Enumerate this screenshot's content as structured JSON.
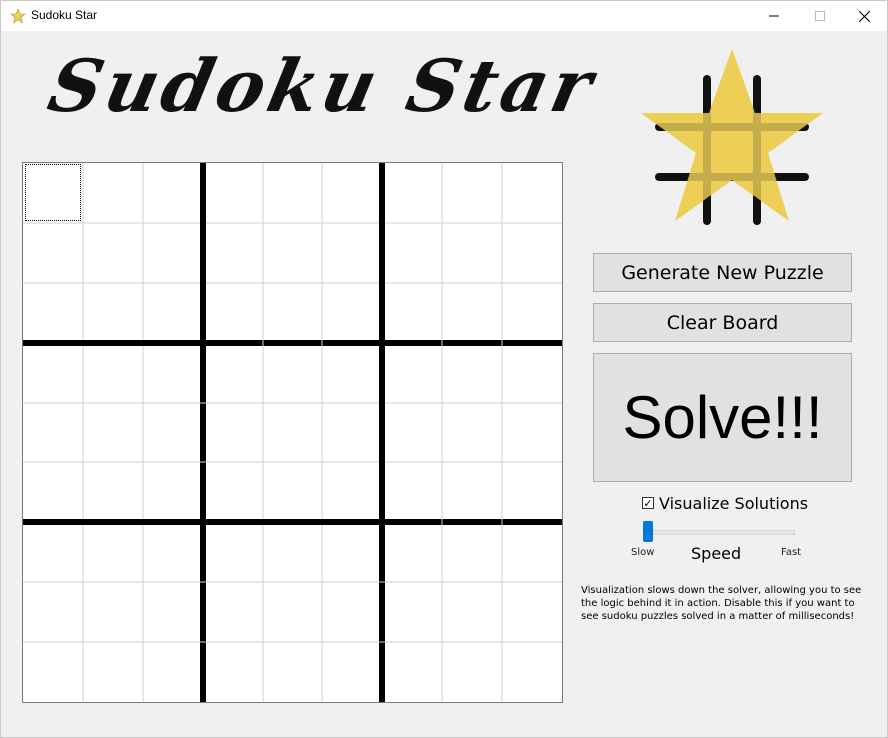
{
  "window": {
    "title": "Sudoku Star",
    "controls": [
      "minimize-icon",
      "maximize-icon",
      "close-icon"
    ]
  },
  "header": {
    "heading": "Sudoku Star",
    "logo_icon": "star-icon"
  },
  "board": {
    "size": 9,
    "cells": [
      [
        "",
        "",
        "",
        "",
        "",
        "",
        "",
        "",
        ""
      ],
      [
        "",
        "",
        "",
        "",
        "",
        "",
        "",
        "",
        ""
      ],
      [
        "",
        "",
        "",
        "",
        "",
        "",
        "",
        "",
        ""
      ],
      [
        "",
        "",
        "",
        "",
        "",
        "",
        "",
        "",
        ""
      ],
      [
        "",
        "",
        "",
        "",
        "",
        "",
        "",
        "",
        ""
      ],
      [
        "",
        "",
        "",
        "",
        "",
        "",
        "",
        "",
        ""
      ],
      [
        "",
        "",
        "",
        "",
        "",
        "",
        "",
        "",
        ""
      ],
      [
        "",
        "",
        "",
        "",
        "",
        "",
        "",
        "",
        ""
      ],
      [
        "",
        "",
        "",
        "",
        "",
        "",
        "",
        "",
        ""
      ]
    ]
  },
  "controls": {
    "generate_label": "Generate New Puzzle",
    "clear_label": "Clear Board",
    "solve_label": "Solve!!!",
    "visualize_label": "Visualize Solutions",
    "visualize_checked": true,
    "speed_label": "Speed",
    "slow_label": "Slow",
    "fast_label": "Fast",
    "speed_value": 0
  },
  "note": "Visualization slows down the solver, allowing you to see the logic behind it in action. Disable this if you want to see sudoku puzzles solved in a matter of milliseconds!",
  "colors": {
    "star": "#edce57",
    "hash": "#111111",
    "accent": "#0078d7"
  }
}
